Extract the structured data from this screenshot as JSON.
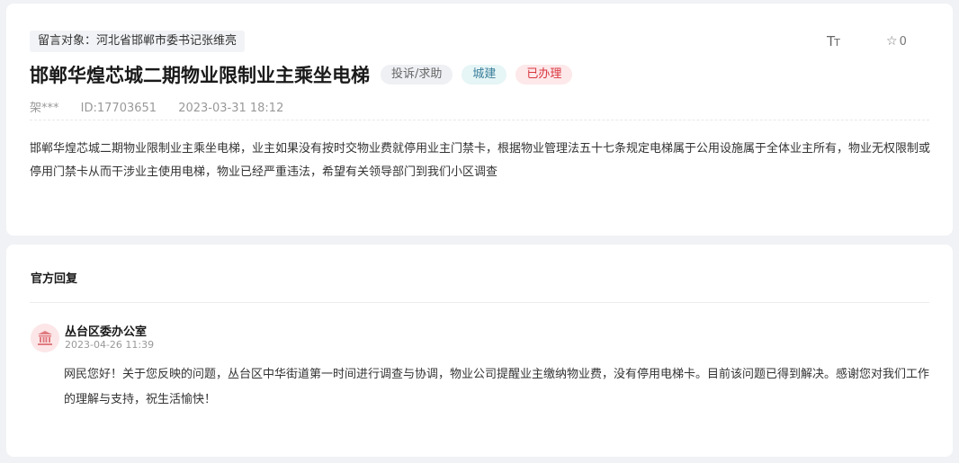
{
  "message": {
    "target_label": "留言对象：河北省邯郸市委书记张维亮",
    "font_size_icon": "Tт",
    "favorite_count": "0",
    "title": "邯郸华煌芯城二期物业限制业主乘坐电梯",
    "badges": {
      "type": "投诉/求助",
      "domain": "城建",
      "status": "已办理"
    },
    "author": "架***",
    "id_label": "ID:17703651",
    "datetime": "2023-03-31 18:12",
    "content": "邯郸华煌芯城二期物业限制业主乘坐电梯，业主如果没有按时交物业费就停用业主门禁卡，根据物业管理法五十七条规定电梯属于公用设施属于全体业主所有，物业无权限制或停用门禁卡从而干涉业主使用电梯，物业已经严重违法，希望有关领导部门到我们小区调查"
  },
  "reply": {
    "heading": "官方回复",
    "org_name": "丛台区委办公室",
    "datetime": "2023-04-26 11:39",
    "content": "网民您好！关于您反映的问题，丛台区中华街道第一时间进行调查与协调，物业公司提醒业主缴纳物业费，没有停用电梯卡。目前该问题已得到解决。感谢您对我们工作的理解与支持，祝生活愉快！"
  },
  "colors": {
    "status_red": "#d9363e",
    "domain_teal": "#3a7f9a",
    "page_bg": "#f1f2f5"
  },
  "icons": {
    "font_size": "font-size-icon",
    "favorite": "star-outline-icon",
    "org_avatar": "government-building-icon"
  }
}
